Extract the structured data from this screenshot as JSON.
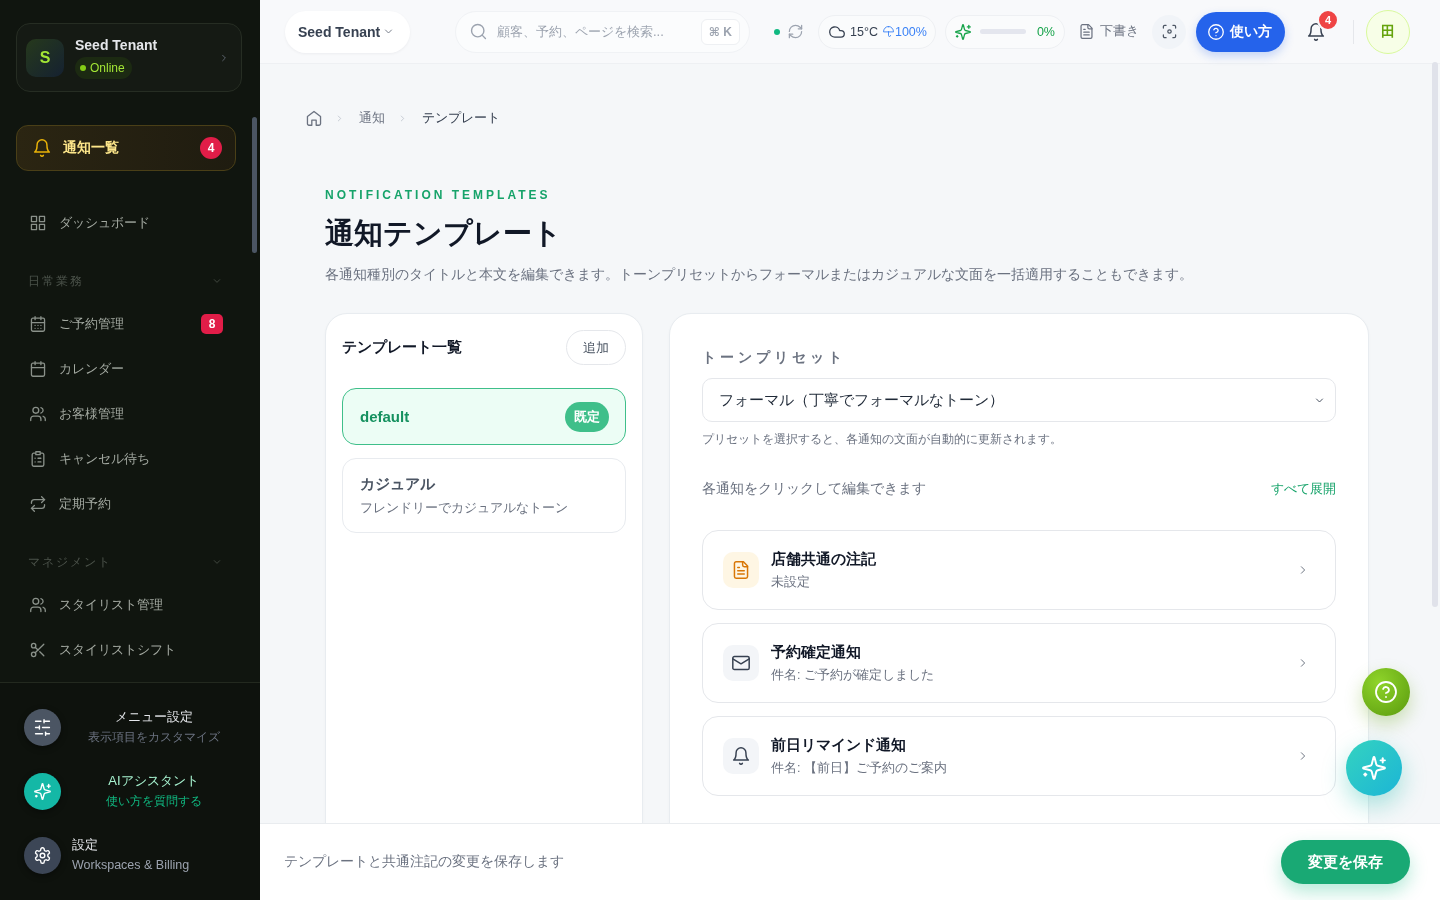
{
  "sidebar": {
    "tenant": {
      "initial": "S",
      "name": "Seed Tenant",
      "status": "Online"
    },
    "pinned": {
      "label": "通知一覧",
      "badge": "4",
      "selected": true
    },
    "groups": [
      {
        "items": [
          {
            "label": "ダッシュボード",
            "selected": false
          }
        ]
      },
      {
        "title": "日常業務",
        "expanded": true,
        "items": [
          {
            "label": "ご予約管理",
            "badge": "8",
            "selected": false
          },
          {
            "label": "カレンダー",
            "selected": false
          },
          {
            "label": "お客様管理",
            "selected": false
          },
          {
            "label": "キャンセル待ち",
            "selected": false
          },
          {
            "label": "定期予約",
            "selected": false
          }
        ]
      },
      {
        "title": "マネジメント",
        "expanded": true,
        "items": [
          {
            "label": "スタイリスト管理",
            "selected": false
          },
          {
            "label": "スタイリストシフト",
            "selected": false
          }
        ]
      }
    ],
    "footer": [
      {
        "kind": "customize",
        "title": "メニュー設定",
        "subtitle": "表示項目をカスタマイズ"
      },
      {
        "kind": "assistant",
        "title": "AIアシスタント",
        "subtitle": "使い方を質問する"
      },
      {
        "kind": "settings",
        "title": "設定",
        "subtitle": "Workspaces & Billing"
      }
    ]
  },
  "topbar": {
    "tenant_select": {
      "value": "Seed Tenant"
    },
    "search": {
      "placeholder": "顧客、予約、ページを検索...",
      "shortcut": "⌘ K"
    },
    "sync": {
      "online": true
    },
    "weather": {
      "temperature": "15°C",
      "precipitation": "100%"
    },
    "ai_usage": {
      "reading": "0%"
    },
    "draft": {
      "label": "下書き"
    },
    "help_button": {
      "label": "使い方"
    },
    "notifications": {
      "badge": "4"
    },
    "user": {
      "initial": "田"
    }
  },
  "breadcrumb": [
    "通知",
    "テンプレート"
  ],
  "header": {
    "eyebrow": "NOTIFICATION TEMPLATES",
    "title": "通知テンプレート",
    "description": "各通知種別のタイトルと本文を編集できます。トーンプリセットからフォーマルまたはカジュアルな文面を一括適用することもできます。"
  },
  "templates": {
    "title": "テンプレート一覧",
    "add_button": "追加",
    "items": [
      {
        "name": "default",
        "badge": "既定",
        "selected": true
      },
      {
        "name": "カジュアル",
        "description": "フレンドリーでカジュアルなトーン",
        "selected": false
      }
    ]
  },
  "tone_preset": {
    "label": "トーンプリセット",
    "value": "フォーマル（丁寧でフォーマルなトーン）",
    "help": "プリセットを選択すると、各通知の文面が自動的に更新されます。"
  },
  "notification_list": {
    "hint": "各通知をクリックして編集できます",
    "expand_all": "すべて展開",
    "items": [
      {
        "kind": "note",
        "title": "店舗共通の注記",
        "subtitle": "未設定"
      },
      {
        "kind": "mail",
        "title": "予約確定通知",
        "subtitle": "件名: ご予約が確定しました"
      },
      {
        "kind": "reminder",
        "title": "前日リマインド通知",
        "subtitle": "件名: 【前日】ご予約のご案内"
      }
    ]
  },
  "save_bar": {
    "message": "テンプレートと共通注記の変更を保存します",
    "button": "変更を保存"
  }
}
